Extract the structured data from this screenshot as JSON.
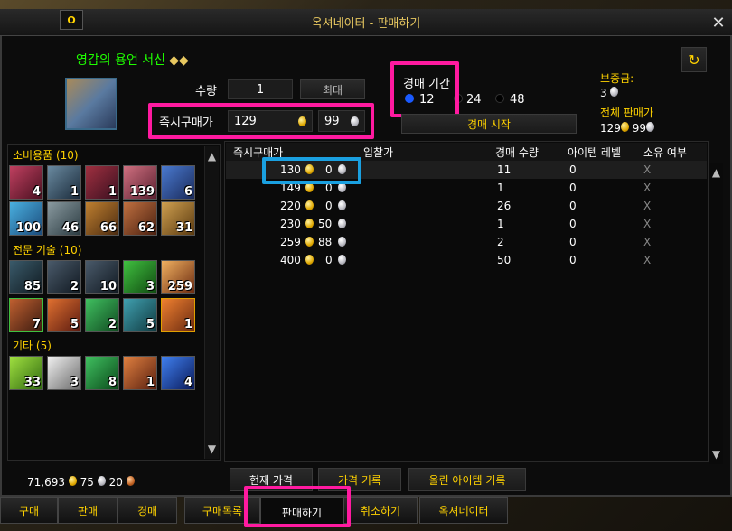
{
  "window": {
    "title": "옥셔네이터 - 판매하기",
    "portrait_label": "O",
    "close": "✕"
  },
  "item": {
    "name": "영감의 용언 서신",
    "quality_glyph": "◆◆"
  },
  "quantity": {
    "label": "수량",
    "value": "1",
    "max_label": "최대"
  },
  "buyout": {
    "label": "즉시구매가",
    "gold": "129",
    "silver": "99"
  },
  "duration": {
    "label": "경매 기간",
    "options": [
      "12",
      "24",
      "48"
    ],
    "selected": "12"
  },
  "start_button": "경매 시작",
  "deposit": {
    "label": "보증금:",
    "value": "3"
  },
  "total": {
    "label": "전체 판매가",
    "gold": "129",
    "silver": "99"
  },
  "categories": [
    {
      "label": "소비용품 (10)",
      "items": [
        "4",
        "1",
        "1",
        "139",
        "6",
        "100",
        "46",
        "66",
        "62",
        "31"
      ]
    },
    {
      "label": "전문 기술 (10)",
      "items": [
        "85",
        "2",
        "10",
        "3",
        "259",
        "7",
        "5",
        "2",
        "5",
        "1"
      ]
    },
    {
      "label": "기타 (5)",
      "items": [
        "33",
        "3",
        "8",
        "1",
        "4"
      ]
    }
  ],
  "table": {
    "headers": [
      "즉시구매가",
      "입찰가",
      "경매 수량",
      "아이템 레벨",
      "소유 여부"
    ],
    "rows": [
      {
        "gold": "130",
        "silver": "0",
        "qty": "11",
        "ilvl": "0",
        "own": "X"
      },
      {
        "gold": "149",
        "silver": "0",
        "qty": "1",
        "ilvl": "0",
        "own": "X"
      },
      {
        "gold": "220",
        "silver": "0",
        "qty": "26",
        "ilvl": "0",
        "own": "X"
      },
      {
        "gold": "230",
        "silver": "50",
        "qty": "1",
        "ilvl": "0",
        "own": "X"
      },
      {
        "gold": "259",
        "silver": "88",
        "qty": "2",
        "ilvl": "0",
        "own": "X"
      },
      {
        "gold": "400",
        "silver": "0",
        "qty": "50",
        "ilvl": "0",
        "own": "X"
      }
    ]
  },
  "money": {
    "gold": "71,693",
    "silver": "75",
    "copper": "20"
  },
  "sub_tabs": [
    "현재 가격",
    "가격 기록",
    "올린 아이템 기록"
  ],
  "bottom_tabs": [
    "구매",
    "판매",
    "경매",
    "구매목록",
    "판매하기",
    "취소하기",
    "옥셔네이터"
  ],
  "colors": {
    "highlight": "#ff1aa0",
    "highlight_blue": "#1aa0e0",
    "item_name": "#1eff00",
    "gold_text": "#ffd200"
  }
}
